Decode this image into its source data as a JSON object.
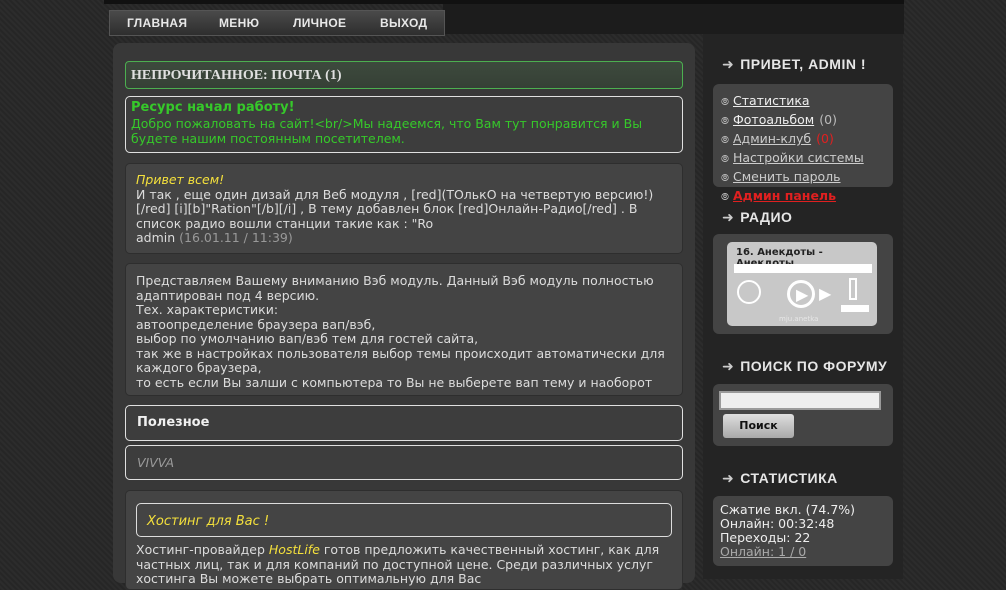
{
  "nav": {
    "items": [
      "ГЛАВНАЯ",
      "МЕНЮ",
      "ЛИЧНОЕ",
      "ВЫХОД"
    ]
  },
  "main": {
    "unread_title": "НЕПРОЧИТАННОЕ: ПОЧТА (1)",
    "welcome": {
      "heading": "Ресурс начал работу!",
      "text": "Добро пожаловать на сайт!<br/>Мы надеемся, что Вам тут понравится и Вы будете нашим постоянным посетителем."
    },
    "post": {
      "heading": "Привет всем!",
      "text": "И так , еще один дизай для Веб модуля , [red](ТОлькО на четвертую версию!)[/red] [i][b]\"Ration\"[/b][/i] , В тему добавлен блок [red]Онлайн-Радио[/red] . В список радио вошли станции такие как : \"Ro",
      "author": "admin",
      "date": "(16.01.11 / 11:39)"
    },
    "article": {
      "lines": [
        "Представляем Вашему вниманию Вэб модуль. Данный Вэб модуль полностью адаптирован под 4 версию.",
        "Тех. характеристики:",
        "автоопределение браузера вап/вэб,",
        "выбор по умолчанию вап/вэб тем для гостей сайта,",
        "так же в настройках пользователя выбор темы происходит автоматически для каждого браузера,",
        "то есть если Вы залши с компьютера то Вы не выберете вап тему и наоборот"
      ]
    },
    "useful": {
      "title": "Полезное",
      "item": "VIVVA"
    },
    "hosting": {
      "heading": "Хостинг для Вас !",
      "provider": "HostLife",
      "text_before": "Хостинг-провайдер ",
      "text_after": " готов предложить качественный хостинг, как для частных лиц, так и для компаний по доступной цене. Среди различных услуг хостинга Вы можете выбрать оптимальную для Вас"
    }
  },
  "sidebar": {
    "greeting_title": "ПРИВЕТ, ADMIN !",
    "links": [
      {
        "label": "Статистика",
        "count": ""
      },
      {
        "label": "Фотоальбом",
        "count": "(0)"
      },
      {
        "label": "Админ-клуб",
        "count": "(0)"
      },
      {
        "label": "Настройки системы",
        "count": ""
      },
      {
        "label": "Сменить пароль",
        "count": ""
      },
      {
        "label": "Админ панель",
        "count": ""
      }
    ],
    "radio_title": "РАДИО",
    "radio_station": "16. Анекдоты - Анекдоты",
    "radio_footer": "mju.anetka",
    "search_title": "ПОИСК ПО ФОРУМУ",
    "search_button": "Поиск",
    "search_value": "",
    "stats_title": "СТАТИСТИКА",
    "stats": [
      "Сжатие вкл. (74.7%)",
      "Онлайн: 00:32:48",
      "Переходы: 22"
    ],
    "online": "Онлайн: 1 / 0"
  },
  "colors": {
    "green": "#36c92a",
    "yellow": "#f4e03c",
    "red": "#e02020"
  }
}
